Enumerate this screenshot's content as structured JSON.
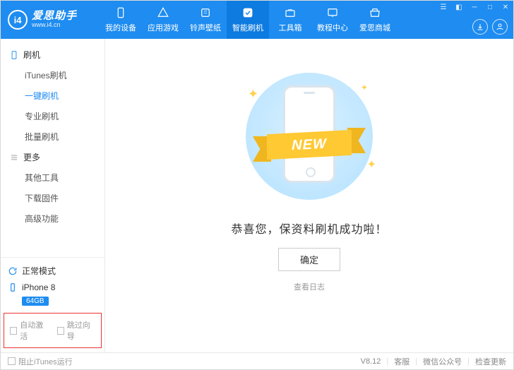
{
  "app": {
    "title": "爱思助手",
    "url": "www.i4.cn",
    "logo_letters": "i4"
  },
  "nav": [
    {
      "label": "我的设备",
      "icon": "device"
    },
    {
      "label": "应用游戏",
      "icon": "apps"
    },
    {
      "label": "铃声壁纸",
      "icon": "ringtone"
    },
    {
      "label": "智能刷机",
      "icon": "flash",
      "active": true
    },
    {
      "label": "工具箱",
      "icon": "toolbox"
    },
    {
      "label": "教程中心",
      "icon": "tutorial"
    },
    {
      "label": "爱思商城",
      "icon": "store"
    }
  ],
  "sidebar": {
    "group1": {
      "title": "刷机",
      "items": [
        "iTunes刷机",
        "一键刷机",
        "专业刷机",
        "批量刷机"
      ],
      "active_index": 1
    },
    "group2": {
      "title": "更多",
      "items": [
        "其他工具",
        "下载固件",
        "高级功能"
      ]
    },
    "mode": {
      "label": "正常模式"
    },
    "device": {
      "name": "iPhone 8",
      "storage": "64GB"
    },
    "footer_checks": {
      "auto_activate": "自动激活",
      "skip_guide": "跳过向导"
    }
  },
  "main": {
    "ribbon_text": "NEW",
    "message": "恭喜您，保资料刷机成功啦！",
    "ok_btn": "确定",
    "log_link": "查看日志"
  },
  "statusbar": {
    "block_itunes": "阻止iTunes运行",
    "version": "V8.12",
    "support": "客服",
    "wechat": "微信公众号",
    "check_update": "检查更新"
  }
}
